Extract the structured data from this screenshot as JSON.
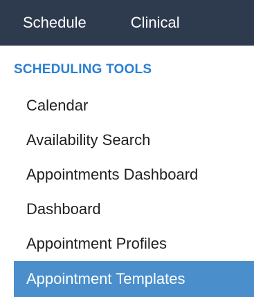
{
  "topnav": {
    "tabs": [
      {
        "label": "Schedule"
      },
      {
        "label": "Clinical"
      }
    ]
  },
  "section": {
    "title": "SCHEDULING TOOLS"
  },
  "menu": {
    "items": [
      {
        "label": "Calendar"
      },
      {
        "label": "Availability Search"
      },
      {
        "label": "Appointments Dashboard"
      },
      {
        "label": "Dashboard"
      },
      {
        "label": "Appointment Profiles"
      },
      {
        "label": "Appointment Templates"
      }
    ],
    "active_index": 5
  },
  "colors": {
    "nav_background": "#2e3b4e",
    "section_title": "#2a7fd4",
    "active_item_background": "#4a8fcc"
  }
}
